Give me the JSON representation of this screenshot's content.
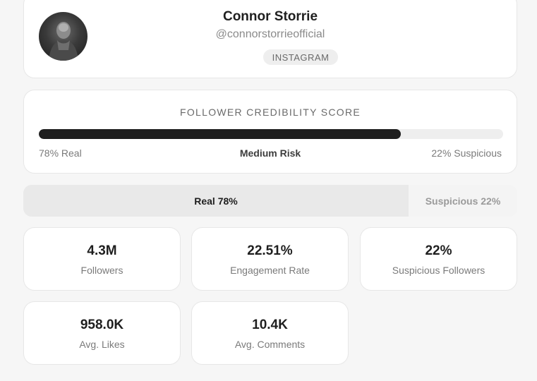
{
  "profile": {
    "name": "Connor Storrie",
    "handle": "@connorstorrieofficial",
    "platform": "INSTAGRAM"
  },
  "credibility": {
    "title": "FOLLOWER CREDIBILITY SCORE",
    "real_fraction": 0.78,
    "left_label": "78% Real",
    "risk_label": "Medium Risk",
    "right_label": "22% Suspicious"
  },
  "split": {
    "real_fraction": 0.78,
    "real_label": "Real 78%",
    "suspicious_label": "Suspicious 22%"
  },
  "stats": [
    {
      "value": "4.3M",
      "label": "Followers"
    },
    {
      "value": "22.51%",
      "label": "Engagement Rate"
    },
    {
      "value": "22%",
      "label": "Suspicious Followers"
    },
    {
      "value": "958.0K",
      "label": "Avg. Likes"
    },
    {
      "value": "10.4K",
      "label": "Avg. Comments"
    }
  ],
  "colors": {
    "bar_fill": "#1e1e1e",
    "bar_track": "#eeeeee",
    "card_bg": "#ffffff",
    "page_bg": "#f6f6f6"
  }
}
